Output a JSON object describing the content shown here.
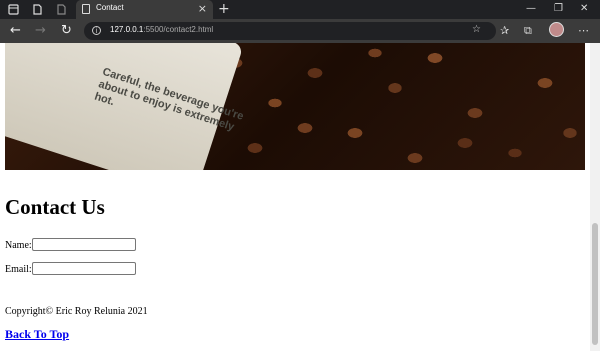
{
  "browser": {
    "tab_title": "Contact",
    "tab_close": "×",
    "new_tab": "+",
    "url_host": "127.0.0.1",
    "url_path": ":5500/contact2.html",
    "window_controls": [
      "—",
      "❐",
      "✕"
    ],
    "nav": {
      "back": "←",
      "forward": "→",
      "reload": "↻"
    },
    "icons": [
      "tab-actions-icon",
      "workspaces-icon",
      "page-icon",
      "favorite-add-icon",
      "favorites-icon",
      "collections-icon",
      "profile-icon",
      "more-icon"
    ]
  },
  "page": {
    "hero_image_text": "Careful, the beverage you're about to enjoy is extremely hot.",
    "title": "Contact Us",
    "form": {
      "name_label": "Name:",
      "email_label": "Email:",
      "name_value": "",
      "email_value": ""
    },
    "copyright": "Copyright© Eric Roy Relunia 2021",
    "back_to_top": "Back To Top"
  },
  "colors": {
    "link": "#0000ee",
    "chrome_dark": "#202124",
    "chrome_mid": "#3b3b3b"
  }
}
